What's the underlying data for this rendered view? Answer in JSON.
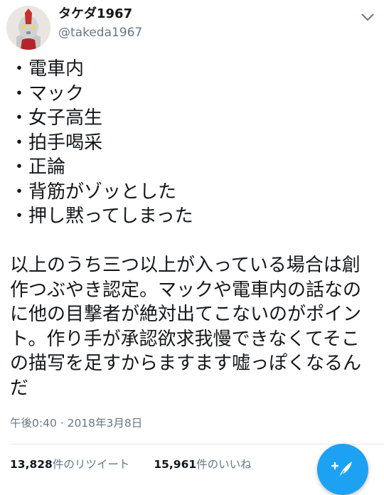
{
  "header": {
    "display_name": "タケダ1967",
    "handle": "@takeda1967"
  },
  "tweet": {
    "bullets": [
      "・電車内",
      "・マック",
      "・女子高生",
      "・拍手喝采",
      "・正論",
      "・背筋がゾッとした",
      "・押し黙ってしまった"
    ],
    "body": "以上のうち三つ以上が入っている場合は創作つぶやき認定。マックや電車内の話なのに他の目撃者が絶対出てこないのがポイント。作り手が承認欲求我慢できなくてそこの描写を足すからますます嘘っぽくなるんだ",
    "timestamp": "午後0:40 · 2018年3月8日"
  },
  "stats": {
    "retweets_count": "13,828",
    "retweets_label": "件のリツイート",
    "likes_count": "15,961",
    "likes_label": "件のいいね"
  },
  "icons": {
    "menu": "chevron-down-icon",
    "compose": "compose-quill-icon"
  },
  "colors": {
    "accent": "#1da1f2",
    "secondary_text": "#657786",
    "primary_text": "#14171a"
  }
}
